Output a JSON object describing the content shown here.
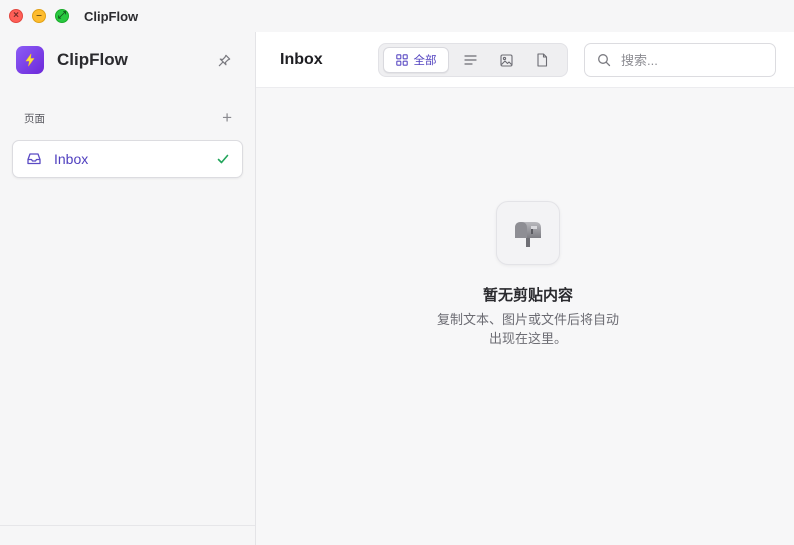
{
  "window": {
    "title": "ClipFlow",
    "controls": {
      "close": "×",
      "minimize": "–",
      "zoom": "⤢"
    }
  },
  "sidebar": {
    "brand_name": "ClipFlow",
    "brand_icon": "lightning-icon",
    "pin_icon": "pin-icon",
    "section_title": "页面",
    "add_label": "+",
    "pages": [
      {
        "label": "Inbox",
        "icon": "inbox-icon",
        "selected": true
      }
    ]
  },
  "main": {
    "title": "Inbox",
    "filters": [
      {
        "label": "全部",
        "icon": "grid-icon",
        "active": true
      },
      {
        "label": "",
        "icon": "text-lines-icon",
        "active": false
      },
      {
        "label": "",
        "icon": "image-icon",
        "active": false
      },
      {
        "label": "",
        "icon": "file-icon",
        "active": false
      }
    ],
    "search": {
      "placeholder": "搜索...",
      "value": ""
    },
    "empty_state": {
      "icon": "mailbox-icon",
      "title": "暂无剪贴内容",
      "description_line1": "复制文本、图片或文件后将自动",
      "description_line2": "出现在这里。"
    }
  },
  "colors": {
    "accent": "#4f3fbf",
    "brand_gradient_start": "#8b5cf6",
    "brand_gradient_end": "#6d28d9",
    "check": "#22a55b"
  }
}
